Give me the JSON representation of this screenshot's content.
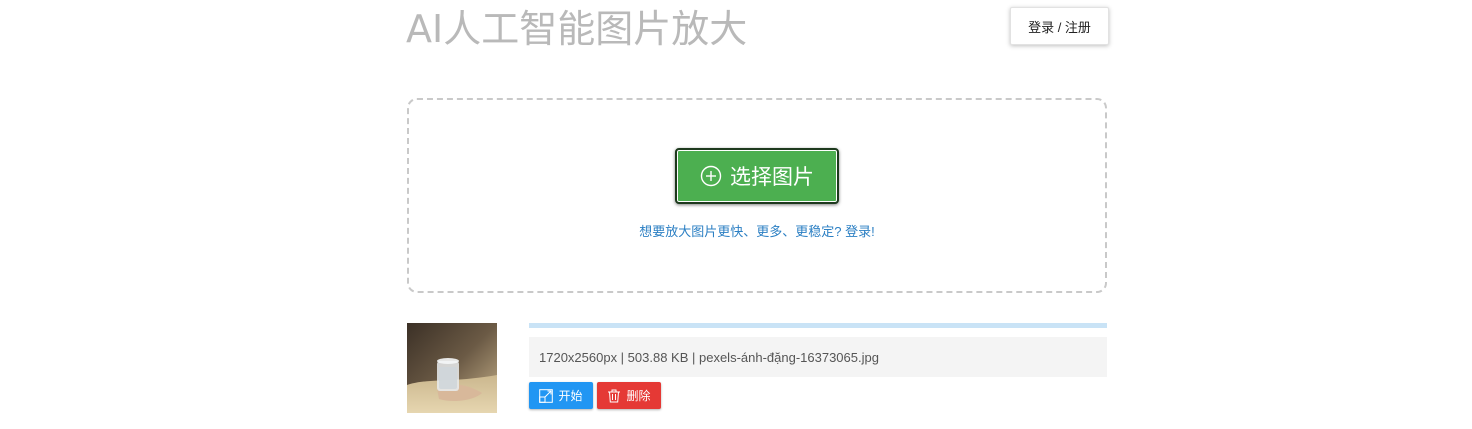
{
  "header": {
    "title": "AI人工智能图片放大",
    "login_label": "登录 / 注册"
  },
  "upload": {
    "select_label": "选择图片",
    "hint": "想要放大图片更快、更多、更稳定? 登录!"
  },
  "file": {
    "info": "1720x2560px | 503.88 KB | pexels-ánh-đặng-16373065.jpg",
    "progress_fraction": 1.0,
    "start_label": "开始",
    "delete_label": "删除"
  },
  "colors": {
    "accent_green": "#4caf50",
    "start_blue": "#2196f3",
    "delete_red": "#e53935",
    "hint_link": "#2b7fc3",
    "progress": "#c9e3f6"
  },
  "icons": {
    "select": "plus-circle-icon",
    "start": "enlarge-icon",
    "delete": "trash-icon"
  }
}
